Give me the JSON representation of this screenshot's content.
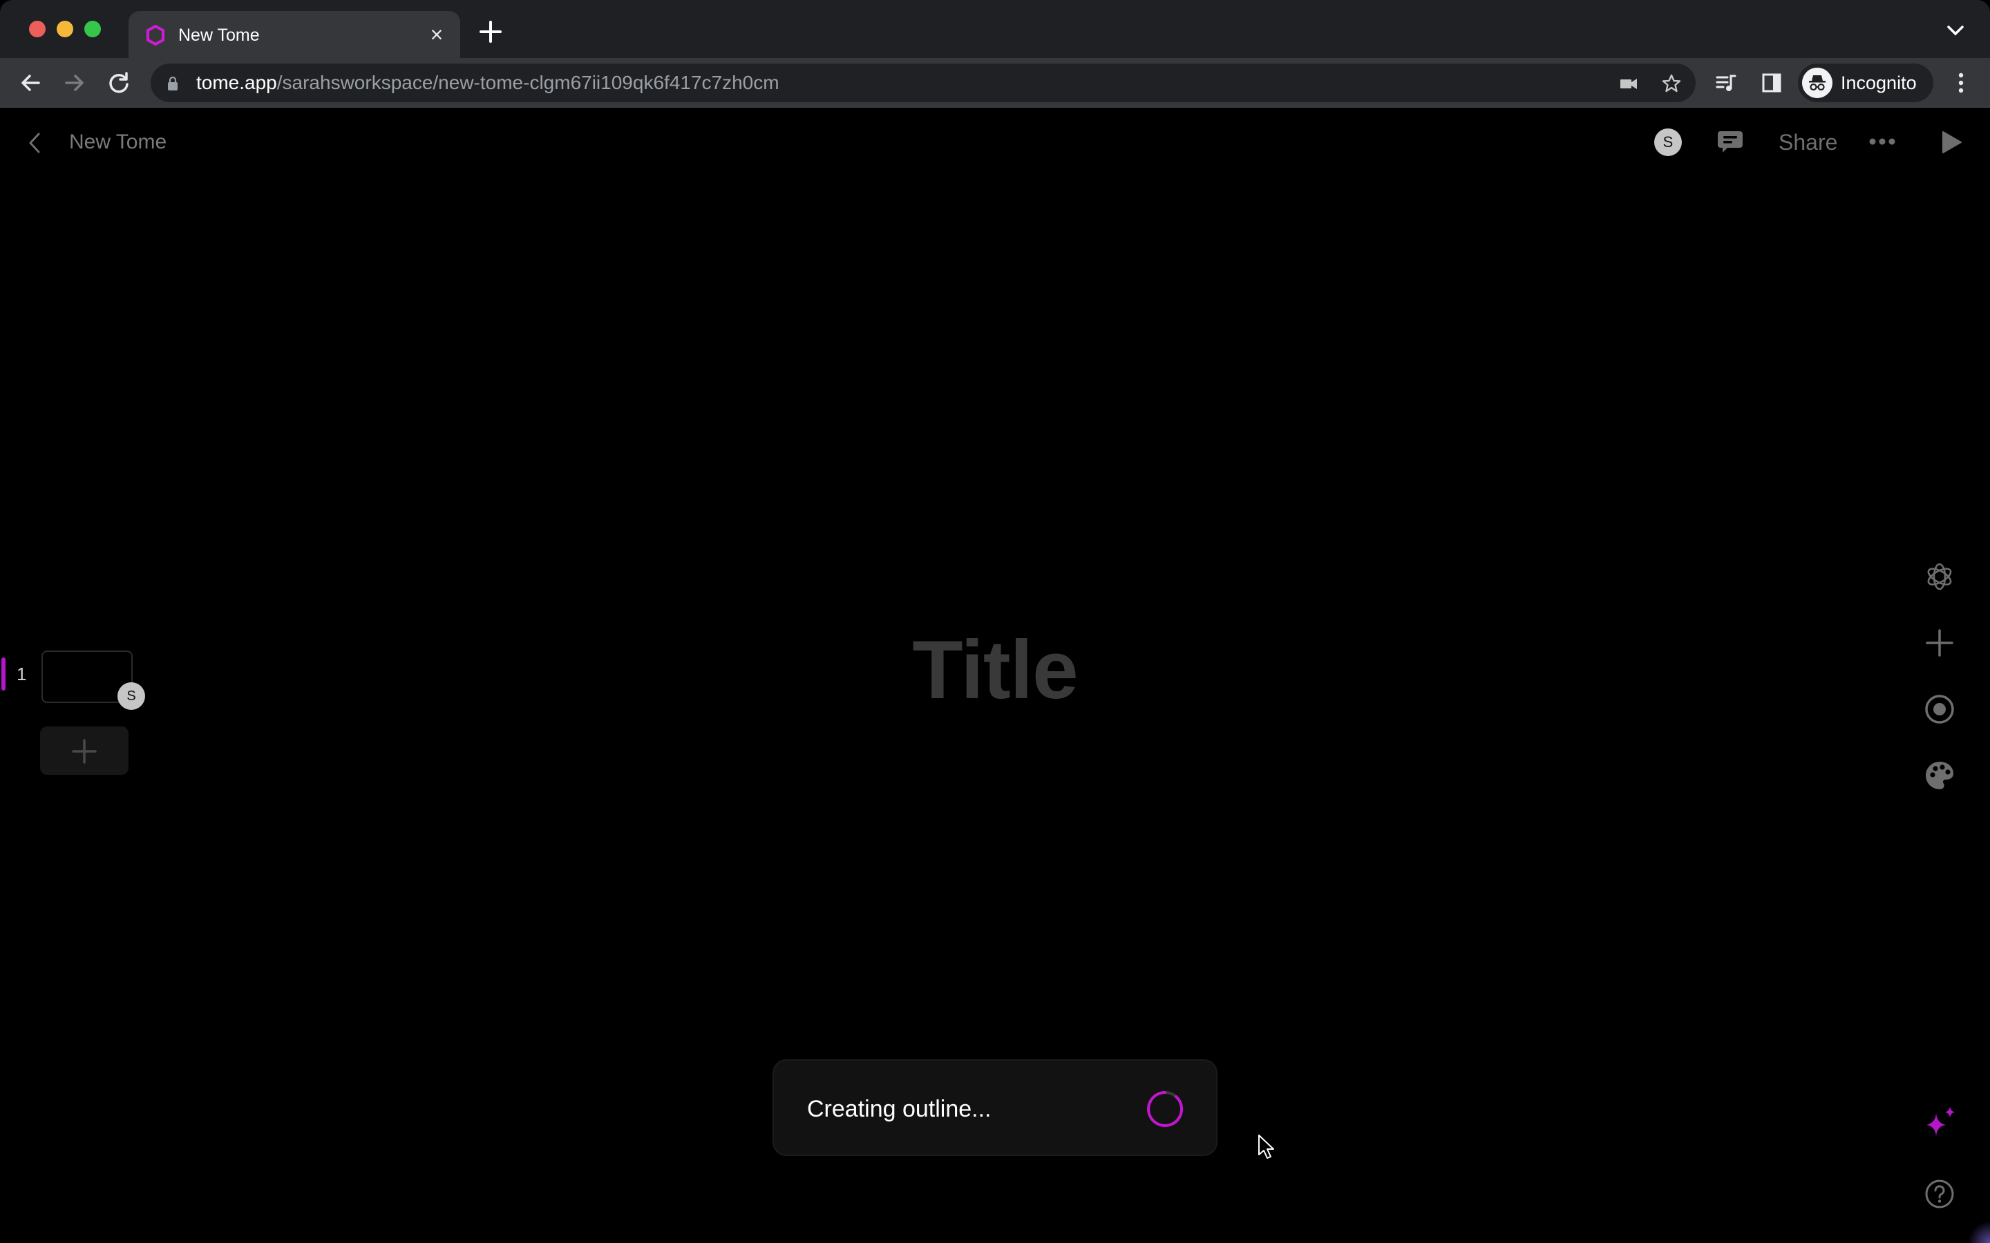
{
  "browser": {
    "tab": {
      "title": "New Tome",
      "favicon": "tome-logo-icon",
      "close_label": "×"
    },
    "new_tab_label": "+",
    "url": {
      "host": "tome.app",
      "path": "/sarahsworkspace/new-tome-clgm67ii109qk6f417c7zh0cm"
    },
    "profile": {
      "label": "Incognito"
    },
    "toolbar_icons": [
      "back-icon",
      "forward-icon",
      "reload-icon",
      "lock-icon",
      "camera-icon",
      "bookmark-star-icon",
      "media-queue-icon",
      "side-panel-icon",
      "incognito-icon",
      "kebab-menu-icon",
      "tab-search-chevron-icon"
    ]
  },
  "app": {
    "header": {
      "back_icon": "chevron-left-icon",
      "title": "New Tome",
      "avatar_initial": "S",
      "share_label": "Share",
      "icons": [
        "comment-icon",
        "more-icon",
        "play-icon"
      ]
    },
    "pages": [
      {
        "number": "1",
        "avatar_initial": "S",
        "active": true
      }
    ],
    "add_page_label": "+",
    "canvas": {
      "title_placeholder": "Title"
    },
    "right_toolbar": [
      "openai-icon",
      "add-tile-icon",
      "record-icon",
      "theme-palette-icon"
    ],
    "bottom_right": [
      "ai-sparkle-icon",
      "help-icon"
    ],
    "toast": {
      "message": "Creating outline...",
      "status": "loading"
    }
  },
  "colors": {
    "accent": "#b516c9",
    "background": "#000000",
    "chrome_dark": "#1f2023",
    "chrome_toolbar": "#36373b",
    "title_placeholder": "#393939",
    "toast_bg": "#121212"
  }
}
